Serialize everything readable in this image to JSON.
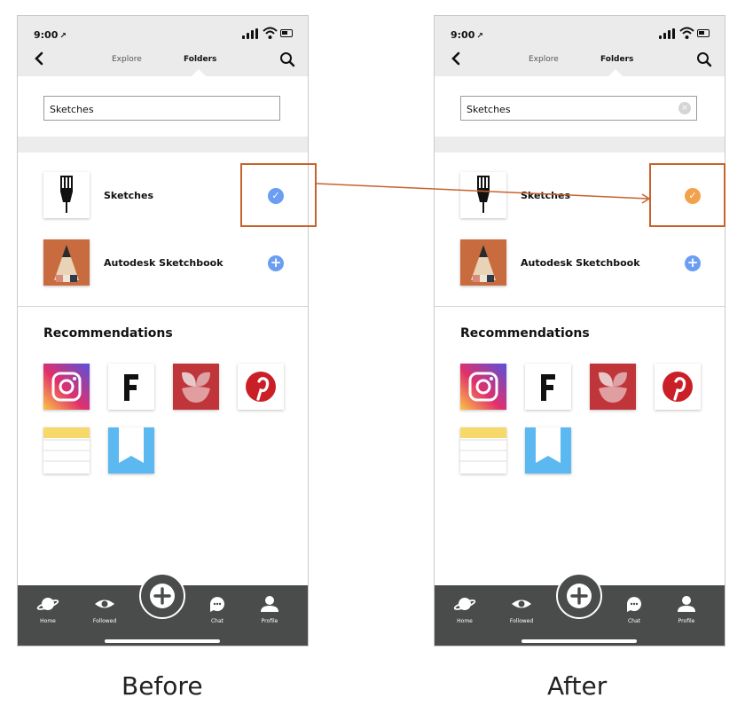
{
  "colors": {
    "highlight": "#c8622d",
    "check_before": "#6b9ef2",
    "check_after": "#f2a24d",
    "add": "#6b9ef2",
    "tabbar": "#4a4b4b",
    "topbar": "#ebebeb"
  },
  "captions": {
    "before": "Before",
    "after": "After"
  },
  "screens": {
    "before": {
      "status": {
        "time": "9:00",
        "location_arrow": "↗"
      },
      "nav": {
        "tabs": [
          "Explore",
          "Folders"
        ],
        "active_tab": "Folders",
        "back_icon": "chevron-left-icon",
        "search_icon": "search-icon"
      },
      "search": {
        "value": "Sketches",
        "clear_icon_visible": false
      },
      "folders": [
        {
          "name": "Sketches",
          "icon": "pen-nib-icon",
          "status": "checked",
          "status_color": "#6b9ef2"
        },
        {
          "name": "Autodesk Sketchbook",
          "icon": "pencil-icon",
          "status": "add",
          "status_color": "#6b9ef2"
        }
      ],
      "recommendations_title": "Recommendations",
      "tabbar": {
        "home": "Home",
        "followed": "Followed",
        "chat": "Chat",
        "profile": "Profile"
      }
    },
    "after": {
      "status": {
        "time": "9:00",
        "location_arrow": "↗"
      },
      "nav": {
        "tabs": [
          "Explore",
          "Folders"
        ],
        "active_tab": "Folders",
        "back_icon": "chevron-left-icon",
        "search_icon": "search-icon"
      },
      "search": {
        "value": "Sketches",
        "clear_icon_visible": true,
        "clear_glyph": "×"
      },
      "folders": [
        {
          "name": "Sketches",
          "icon": "pen-nib-icon",
          "status": "checked",
          "status_color": "#f2a24d"
        },
        {
          "name": "Autodesk Sketchbook",
          "icon": "pencil-icon",
          "status": "add",
          "status_color": "#6b9ef2"
        }
      ],
      "recommendations_title": "Recommendations",
      "tabbar": {
        "home": "Home",
        "followed": "Followed",
        "chat": "Chat",
        "profile": "Profile"
      }
    }
  },
  "recommendation_icons": [
    "instagram-icon",
    "font-f-icon",
    "flower-icon",
    "pinterest-icon",
    "notes-icon",
    "bookmark-icon"
  ],
  "glyphs": {
    "check": "✓",
    "plus": "+",
    "wifi": "≣"
  }
}
